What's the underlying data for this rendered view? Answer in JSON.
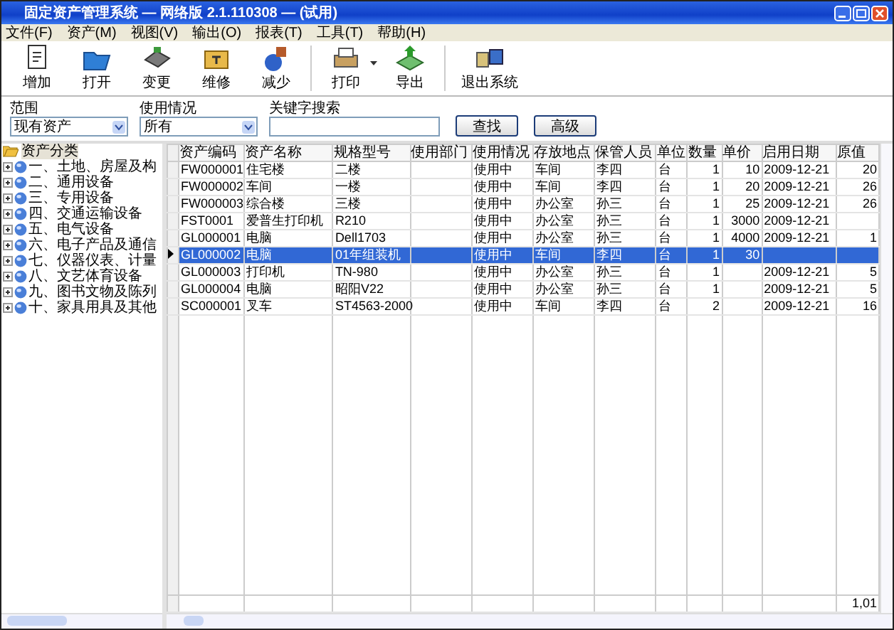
{
  "window": {
    "title": "固定资产管理系统 — 网络版 2.1.110308 — (试用)"
  },
  "menu": [
    "文件(F)",
    "资产(M)",
    "视图(V)",
    "输出(O)",
    "报表(T)",
    "工具(T)",
    "帮助(H)"
  ],
  "toolbar": [
    {
      "label": "增加",
      "dropdown": false
    },
    {
      "label": "打开",
      "dropdown": false
    },
    {
      "label": "变更",
      "dropdown": false
    },
    {
      "label": "维修",
      "dropdown": false
    },
    {
      "label": "减少",
      "dropdown": false
    },
    {
      "label": "打印",
      "dropdown": true
    },
    {
      "label": "导出",
      "dropdown": false
    },
    {
      "label": "退出系统",
      "dropdown": false
    }
  ],
  "filters": {
    "scope": {
      "label": "范围",
      "value": "现有资产"
    },
    "status": {
      "label": "使用情况",
      "value": "所有"
    },
    "keyword": {
      "label": "关键字搜索"
    },
    "buttons": [
      "查找",
      "高级"
    ]
  },
  "tree": {
    "label": "资产分类",
    "expanded": true,
    "selected": true,
    "children": [
      {
        "label": "一、土地、房屋及构",
        "expanded": false,
        "selected": false
      },
      {
        "label": "二、通用设备",
        "expanded": false,
        "selected": false
      },
      {
        "label": "三、专用设备",
        "expanded": false,
        "selected": false
      },
      {
        "label": "四、交通运输设备",
        "expanded": false,
        "selected": false
      },
      {
        "label": "五、电气设备",
        "expanded": false,
        "selected": false
      },
      {
        "label": "六、电子产品及通信",
        "expanded": false,
        "selected": false
      },
      {
        "label": "七、仪器仪表、计量",
        "expanded": false,
        "selected": false
      },
      {
        "label": "八、文艺体育设备",
        "expanded": false,
        "selected": false
      },
      {
        "label": "九、图书文物及陈列",
        "expanded": false,
        "selected": false
      },
      {
        "label": "十、家具用具及其他",
        "expanded": false,
        "selected": false
      }
    ]
  },
  "table": {
    "columns": [
      "资产编码",
      "资产名称",
      "规格型号",
      "使用部门",
      "使用情况",
      "存放地点",
      "保管人员",
      "单位",
      "数量",
      "单价",
      "启用日期",
      "原值"
    ],
    "rows": [
      {
        "selected": false,
        "code": "FW000001",
        "name": "住宅楼",
        "model": "二楼",
        "status": "使用中",
        "location": "车间",
        "keeper": "李四",
        "unit": "台",
        "qty": "1",
        "price": "10",
        "date": "2009-12-21",
        "value": "20"
      },
      {
        "selected": false,
        "code": "FW000002",
        "name": "车间",
        "model": "一楼",
        "status": "使用中",
        "location": "车间",
        "keeper": "李四",
        "unit": "台",
        "qty": "1",
        "price": "20",
        "date": "2009-12-21",
        "value": "26"
      },
      {
        "selected": false,
        "code": "FW000003",
        "name": "综合楼",
        "model": "三楼",
        "status": "使用中",
        "location": "办公室",
        "keeper": "孙三",
        "unit": "台",
        "qty": "1",
        "price": "25",
        "date": "2009-12-21",
        "value": "26"
      },
      {
        "selected": false,
        "code": "FST0001",
        "name": "爱普生打印机",
        "model": "R210",
        "status": "使用中",
        "location": "办公室",
        "keeper": "孙三",
        "unit": "台",
        "qty": "1",
        "price": "3000",
        "date": "2009-12-21"
      },
      {
        "selected": false,
        "code": "GL000001",
        "name": "电脑",
        "model": "Dell1703",
        "status": "使用中",
        "location": "办公室",
        "keeper": "孙三",
        "unit": "台",
        "qty": "1",
        "price": "4000",
        "date": "2009-12-21",
        "value": "1"
      },
      {
        "selected": true,
        "code": "GL000002",
        "name": "电脑",
        "model": "01年组装机",
        "status": "使用中",
        "location": "车间",
        "keeper": "李四",
        "unit": "台",
        "qty": "1",
        "price": "30"
      },
      {
        "selected": false,
        "code": "GL000003",
        "name": "打印机",
        "model": "TN-980",
        "status": "使用中",
        "location": "办公室",
        "keeper": "孙三",
        "unit": "台",
        "qty": "1",
        "date": "2009-12-21",
        "value": "5"
      },
      {
        "selected": false,
        "code": "GL000004",
        "name": "电脑",
        "model": "昭阳V22",
        "status": "使用中",
        "location": "办公室",
        "keeper": "孙三",
        "unit": "台",
        "qty": "1",
        "date": "2009-12-21",
        "value": "5"
      },
      {
        "selected": false,
        "code": "SC000001",
        "name": "叉车",
        "model": "ST4563-2000",
        "status": "使用中",
        "location": "车间",
        "keeper": "李四",
        "unit": "台",
        "qty": "2",
        "date": "2009-12-21",
        "value": "16"
      }
    ],
    "total": "1,01"
  }
}
